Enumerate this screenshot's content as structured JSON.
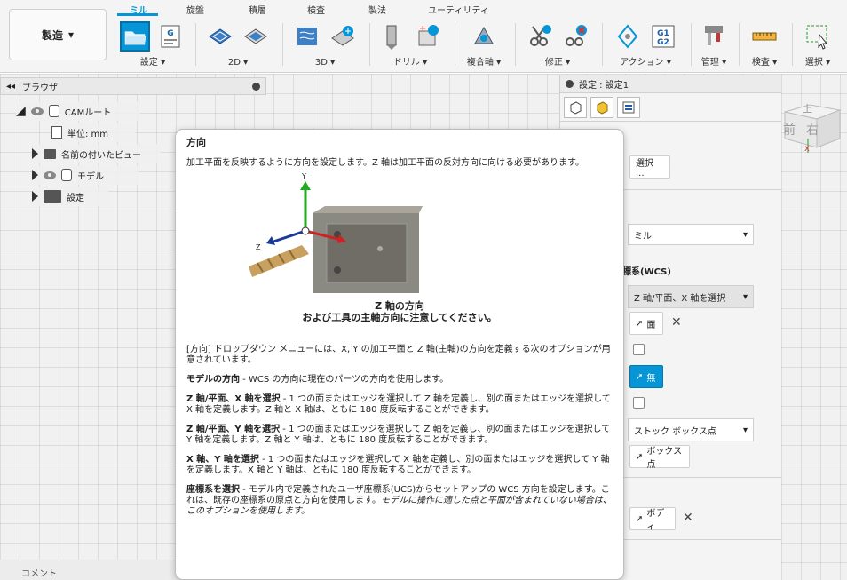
{
  "ribbon": {
    "workspace": "製造",
    "tabs": [
      "ミル",
      "旋盤",
      "積層",
      "検査",
      "製法",
      "ユーティリティ"
    ],
    "groups": {
      "setup": "設定",
      "two_d": "2D",
      "three_d": "3D",
      "drill": "ドリル",
      "multi_axis": "複合軸",
      "modify": "修正",
      "actions": "アクション",
      "manage": "管理",
      "inspect": "検査",
      "select": "選択"
    },
    "g1g2": "G1\nG2"
  },
  "browser": {
    "title": "ブラウザ",
    "items": [
      "CAMルート",
      "単位: mm",
      "名前の付いたビュー",
      "モデル",
      "設定"
    ]
  },
  "settings_panel": {
    "title": "設定 : 設定1",
    "select_button": "選択 ...",
    "mill_dropdown": "ミル",
    "wcs_heading": "標系(WCS)",
    "orientation_dropdown": "Z 軸/平面、X 軸を選択",
    "face_button": "面",
    "none_button": "無",
    "origin_dropdown": "ストック ボックス点",
    "box_point_button": "ボックス点",
    "body_button": "ボディ"
  },
  "viewcube": {
    "top": "上",
    "front": "前",
    "right": "右"
  },
  "comment": "コメント",
  "tooltip": {
    "title": "方向",
    "intro": "加工平面を反映するように方向を設定します。Z 軸は加工平面の反対方向に向ける必要があります。",
    "axis_y": "Y",
    "axis_z": "Z",
    "caption_line1": "Z 軸の方向",
    "caption_line2": "および工具の主軸方向に注意してください。",
    "dropdown_desc": "[方向] ドロップダウン メニューには、X, Y の加工平面と Z 軸(主軸)の方向を定義する次のオプションが用意されています。",
    "opt1_title": "モデルの方向",
    "opt1_body": " - WCS の方向に現在のパーツの方向を使用します。",
    "opt2_title": "Z 軸/平面、X 軸を選択",
    "opt2_body": " - 1 つの面またはエッジを選択して Z 軸を定義し、別の面またはエッジを選択して X 軸を定義します。Z 軸と X 軸は、ともに 180 度反転することができます。",
    "opt3_title": "Z 軸/平面、Y 軸を選択",
    "opt3_body": " - 1 つの面またはエッジを選択して Z 軸を定義し、別の面またはエッジを選択して Y 軸を定義します。Z 軸と Y 軸は、ともに 180 度反転することができます。",
    "opt4_title": "X 軸、Y 軸を選択",
    "opt4_body": " - 1 つの面またはエッジを選択して X 軸を定義し、別の面またはエッジを選択して Y 軸を定義します。X 軸と Y 軸は、ともに 180 度反転することができます。",
    "opt5_title": "座標系を選択",
    "opt5_body": " - モデル内で定義されたユーザ座標系(UCS)からセットアップの WCS 方向を設定します。これは、既存の座標系の原点と方向を使用します。",
    "opt5_italic": "モデルに操作に適した点と平面が含まれていない場合は、このオプションを使用します。"
  },
  "colors": {
    "accent": "#0696d7",
    "y_axis": "#22aa22",
    "x_axis": "#cc2222",
    "z_axis": "#1a3a9a"
  }
}
